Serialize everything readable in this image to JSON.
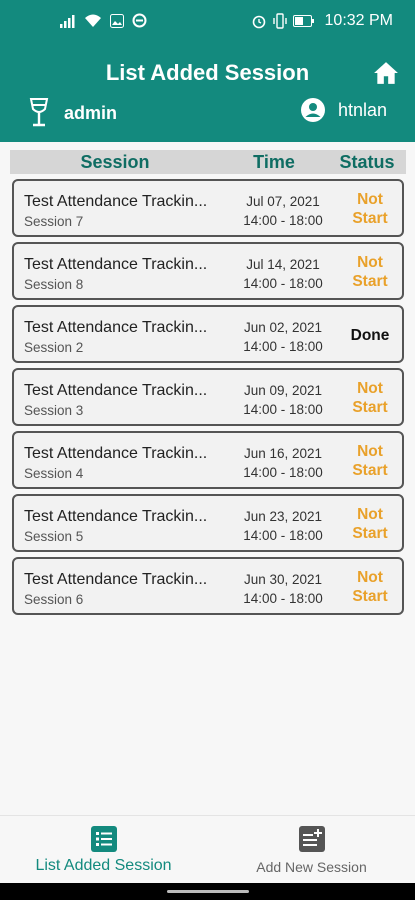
{
  "status_bar": {
    "time": "10:32 PM"
  },
  "header": {
    "title": "List Added Session",
    "left_user": "admin",
    "right_user": "htnlan"
  },
  "columns": {
    "session": "Session",
    "time": "Time",
    "status": "Status"
  },
  "sessions": [
    {
      "title": "Test Attendance Trackin...",
      "subtitle": "Session 7",
      "date": "Jul 07, 2021",
      "hours": "14:00 - 18:00",
      "status": "Not Start"
    },
    {
      "title": "Test Attendance Trackin...",
      "subtitle": "Session 8",
      "date": "Jul 14, 2021",
      "hours": "14:00 - 18:00",
      "status": "Not Start"
    },
    {
      "title": "Test Attendance Trackin...",
      "subtitle": "Session 2",
      "date": "Jun 02, 2021",
      "hours": "14:00 - 18:00",
      "status": "Done"
    },
    {
      "title": "Test Attendance Trackin...",
      "subtitle": "Session 3",
      "date": "Jun 09, 2021",
      "hours": "14:00 - 18:00",
      "status": "Not Start"
    },
    {
      "title": "Test Attendance Trackin...",
      "subtitle": "Session 4",
      "date": "Jun 16, 2021",
      "hours": "14:00 - 18:00",
      "status": "Not Start"
    },
    {
      "title": "Test Attendance Trackin...",
      "subtitle": "Session 5",
      "date": "Jun 23, 2021",
      "hours": "14:00 - 18:00",
      "status": "Not Start"
    },
    {
      "title": "Test Attendance Trackin...",
      "subtitle": "Session 6",
      "date": "Jun 30, 2021",
      "hours": "14:00 - 18:00",
      "status": "Not Start"
    }
  ],
  "bottom_nav": [
    {
      "label": "List Added Session",
      "icon": "list-icon",
      "active": true
    },
    {
      "label": "Add New Session",
      "icon": "add-note-icon",
      "active": false
    }
  ],
  "colors": {
    "primary": "#138a7e",
    "pending": "#e9a12a",
    "done": "#111111",
    "header_row": "#d6d6d6"
  }
}
